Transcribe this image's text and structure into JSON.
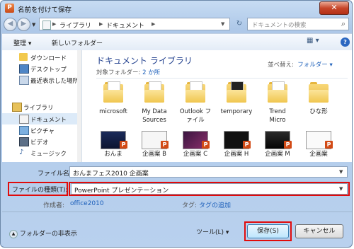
{
  "window": {
    "title": "名前を付けて保存",
    "app_icon_letter": "P",
    "close_glyph": "✕"
  },
  "nav_bar": {
    "back_glyph": "◀",
    "forward_glyph": "▶",
    "path": [
      "ライブラリ",
      "ドキュメント"
    ],
    "separator": "▶",
    "search_placeholder": "ドキュメントの検索"
  },
  "toolbar": {
    "organize": "整理",
    "new_folder": "新しいフォルダー"
  },
  "sidebar": {
    "items": [
      {
        "label": "ダウンロード",
        "icon": "download-folder-icon"
      },
      {
        "label": "デスクトップ",
        "icon": "desktop-icon"
      },
      {
        "label": "最近表示した場所",
        "icon": "recent-places-icon"
      },
      {
        "label": "ライブラリ",
        "icon": "library-icon"
      },
      {
        "label": "ドキュメント",
        "icon": "documents-icon"
      },
      {
        "label": "ピクチャ",
        "icon": "pictures-icon"
      },
      {
        "label": "ビデオ",
        "icon": "videos-icon"
      },
      {
        "label": "ミュージック",
        "icon": "music-icon"
      }
    ]
  },
  "main": {
    "library_title": "ドキュメント ライブラリ",
    "target_label": "対象フォルダー:",
    "target_value": "2 か所",
    "arrange_label": "並べ替え:",
    "arrange_value": "フォルダー ▾",
    "folders": [
      {
        "label": "microsoft",
        "label2": ""
      },
      {
        "label": "My Data",
        "label2": "Sources"
      },
      {
        "label": "Outlook フ",
        "label2": "ァイル"
      },
      {
        "label": "temporary",
        "label2": ""
      },
      {
        "label": "Trend",
        "label2": "Micro"
      },
      {
        "label": "ひな形",
        "label2": ""
      }
    ],
    "files": [
      {
        "label": "おんま",
        "badge": "P"
      },
      {
        "label": "企画案 B",
        "badge": "P"
      },
      {
        "label": "企画案 C",
        "badge": "P"
      },
      {
        "label": "企画案 H",
        "badge": "P"
      },
      {
        "label": "企画案 M",
        "badge": "P"
      },
      {
        "label": "企画案",
        "badge": "P"
      }
    ]
  },
  "form": {
    "filename_label": "ファイル名(N):",
    "filename_value": "おんまフェス2010 企画案",
    "filetype_label": "ファイルの種類(T):",
    "filetype_value": "PowerPoint プレゼンテーション",
    "author_label": "作成者:",
    "author_value": "office2010",
    "tags_label": "タグ:",
    "tags_value": "タグの追加"
  },
  "footer": {
    "hide_folders": "フォルダーの非表示",
    "tools": "ツール(L)",
    "save": "保存(S)",
    "cancel": "キャンセル"
  },
  "colors": {
    "highlight_box": "#e10b0b",
    "link": "#1c5fba",
    "library_title": "#1e3d8c"
  }
}
